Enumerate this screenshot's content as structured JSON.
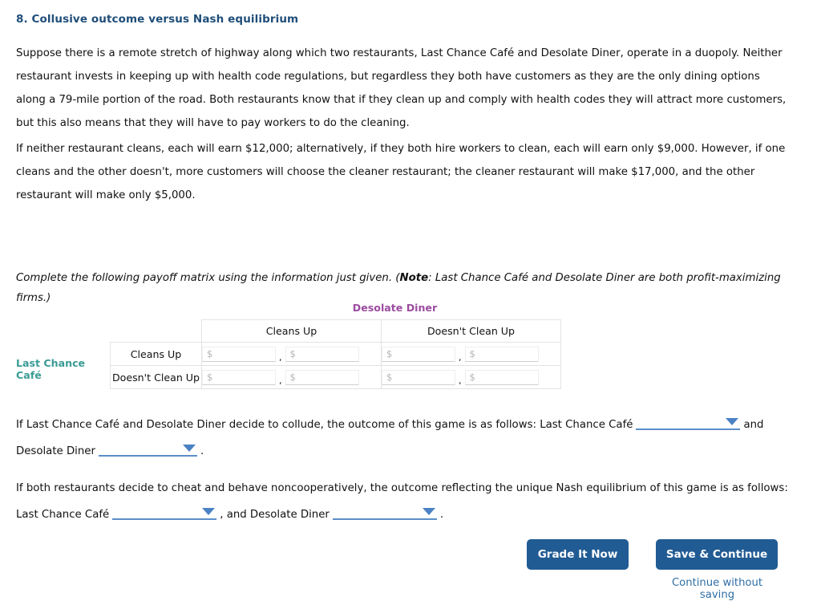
{
  "question": {
    "number_title": "8. Collusive outcome versus Nash equilibrium",
    "paragraph_1": "Suppose there is a remote stretch of highway along which two restaurants, Last Chance Café and Desolate Diner, operate in a duopoly. Neither restaurant invests in keeping up with health code regulations, but regardless they both have customers as they are the only dining options along a 79-mile portion of the road. Both restaurants know that if they clean up and comply with health codes they will attract more customers, but this also means that they will have to pay workers to do the cleaning.",
    "paragraph_2": "If neither restaurant cleans, each will earn $12,000; alternatively, if they both hire workers to clean, each will earn only $9,000. However, if one cleans and the other doesn't, more customers will choose the cleaner restaurant; the cleaner restaurant will make $17,000, and the other restaurant will make only $5,000."
  },
  "instruction": {
    "lead": "Complete the following payoff matrix using the information just given. (",
    "note_label": "Note",
    "tail": ": Last Chance Café and Desolate Diner are both profit-maximizing firms.)"
  },
  "matrix": {
    "column_player": "Desolate Diner",
    "row_player": "Last Chance Café",
    "column_player_color": "#9b4ca0",
    "row_player_color": "#3a9b95",
    "column_headers": [
      "Cleans Up",
      "Doesn't Clean Up"
    ],
    "row_headers": [
      "Cleans Up",
      "Doesn't Clean Up"
    ],
    "separator": ",",
    "cells": [
      [
        {
          "left": {
            "value": "",
            "placeholder": "$"
          },
          "right": {
            "value": "",
            "placeholder": "$"
          }
        },
        {
          "left": {
            "value": "",
            "placeholder": "$"
          },
          "right": {
            "value": "",
            "placeholder": "$"
          }
        }
      ],
      [
        {
          "left": {
            "value": "",
            "placeholder": "$"
          },
          "right": {
            "value": "",
            "placeholder": "$"
          }
        },
        {
          "left": {
            "value": "",
            "placeholder": "$"
          },
          "right": {
            "value": "",
            "placeholder": "$"
          }
        }
      ]
    ]
  },
  "collude_sentence": {
    "part_1": "If Last Chance Café and Desolate Diner decide to collude, the outcome of this game is as follows: Last Chance Café",
    "dropdown_1": "",
    "part_2": "and Desolate Diner",
    "dropdown_2": "",
    "part_3": "."
  },
  "nash_sentence": {
    "part_1": "If both restaurants decide to cheat and behave noncooperatively, the outcome reflecting the unique Nash equilibrium of this game is as follows: Last Chance Café",
    "dropdown_1": "",
    "part_2": ", and Desolate Diner",
    "dropdown_2": "",
    "part_3": "."
  },
  "footer": {
    "grade_label": "Grade It Now",
    "save_label": "Save & Continue",
    "continue_link": "Continue without saving",
    "button_color": "#215b93",
    "link_color": "#2f6ea5"
  }
}
